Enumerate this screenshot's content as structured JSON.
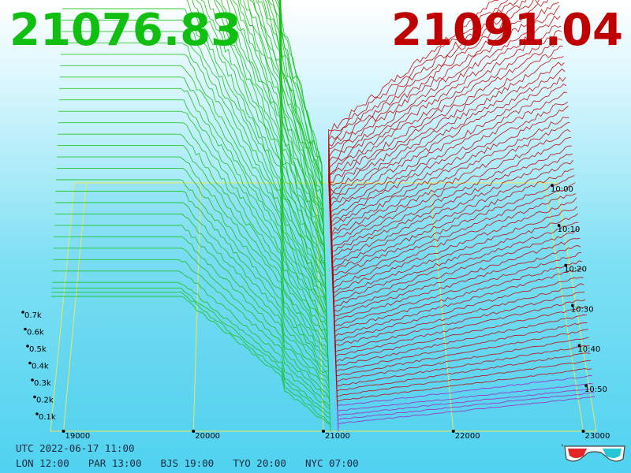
{
  "header": {
    "bid_price": "21076.83",
    "ask_price": "21091.04",
    "bid_color": "#10bf10",
    "ask_color": "#c00000"
  },
  "footer": {
    "utc": "UTC 2022-06-17 11:00",
    "timezones": [
      "LON 12:00",
      "PAR 13:00",
      "BJS 19:00",
      "TYO 20:00",
      "NYC 07:00"
    ]
  },
  "icons": {
    "stereo": "3d-glasses-icon"
  },
  "chart_data": {
    "type": "line",
    "description_kind": "order-book depth (3D)",
    "price_axis": {
      "ticks": [
        19000,
        20000,
        21000,
        22000,
        23000
      ],
      "range": [
        18900,
        23100
      ]
    },
    "volume_axis": {
      "ticks": [
        "0.1k",
        "0.2k",
        "0.3k",
        "0.4k",
        "0.5k",
        "0.6k",
        "0.7k"
      ],
      "values": [
        100,
        200,
        300,
        400,
        500,
        600,
        700
      ]
    },
    "time_axis": {
      "ticks": [
        "10:00",
        "10:10",
        "10:20",
        "10:30",
        "10:40",
        "10:50"
      ]
    },
    "bid_side": {
      "color": "#10bf10",
      "price_range": [
        18900,
        21050
      ]
    },
    "ask_side": {
      "color": "#c00000",
      "price_range": [
        21050,
        23100
      ]
    },
    "spread_mid": 21084,
    "grid": true
  }
}
